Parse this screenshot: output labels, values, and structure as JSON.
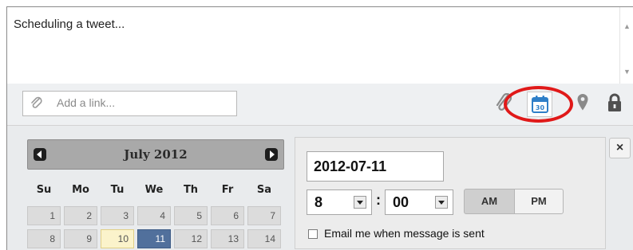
{
  "composer": {
    "text": "Scheduling a tweet..."
  },
  "link_input": {
    "placeholder": "Add a link..."
  },
  "toolbar": {
    "icons": [
      "paperclip-icon",
      "calendar-icon",
      "location-pin-icon",
      "lock-icon"
    ],
    "calendar_icon_text": "30",
    "highlight_color": "#e01919"
  },
  "calendar": {
    "title": "July 2012",
    "weekdays": [
      "Su",
      "Mo",
      "Tu",
      "We",
      "Th",
      "Fr",
      "Sa"
    ],
    "weeks": [
      [
        "1",
        "2",
        "3",
        "4",
        "5",
        "6",
        "7"
      ],
      [
        "8",
        "9",
        "10",
        "11",
        "12",
        "13",
        "14"
      ]
    ],
    "today": "10",
    "selected": "11",
    "selected_color": "#51709c",
    "today_color": "#fbf3cb"
  },
  "schedule": {
    "date_value": "2012-07-11",
    "hour": "8",
    "minute": "00",
    "time_separator": ":",
    "am_label": "AM",
    "pm_label": "PM",
    "active_period": "AM",
    "email_label": "Email me when message is sent",
    "close_label": "×"
  }
}
